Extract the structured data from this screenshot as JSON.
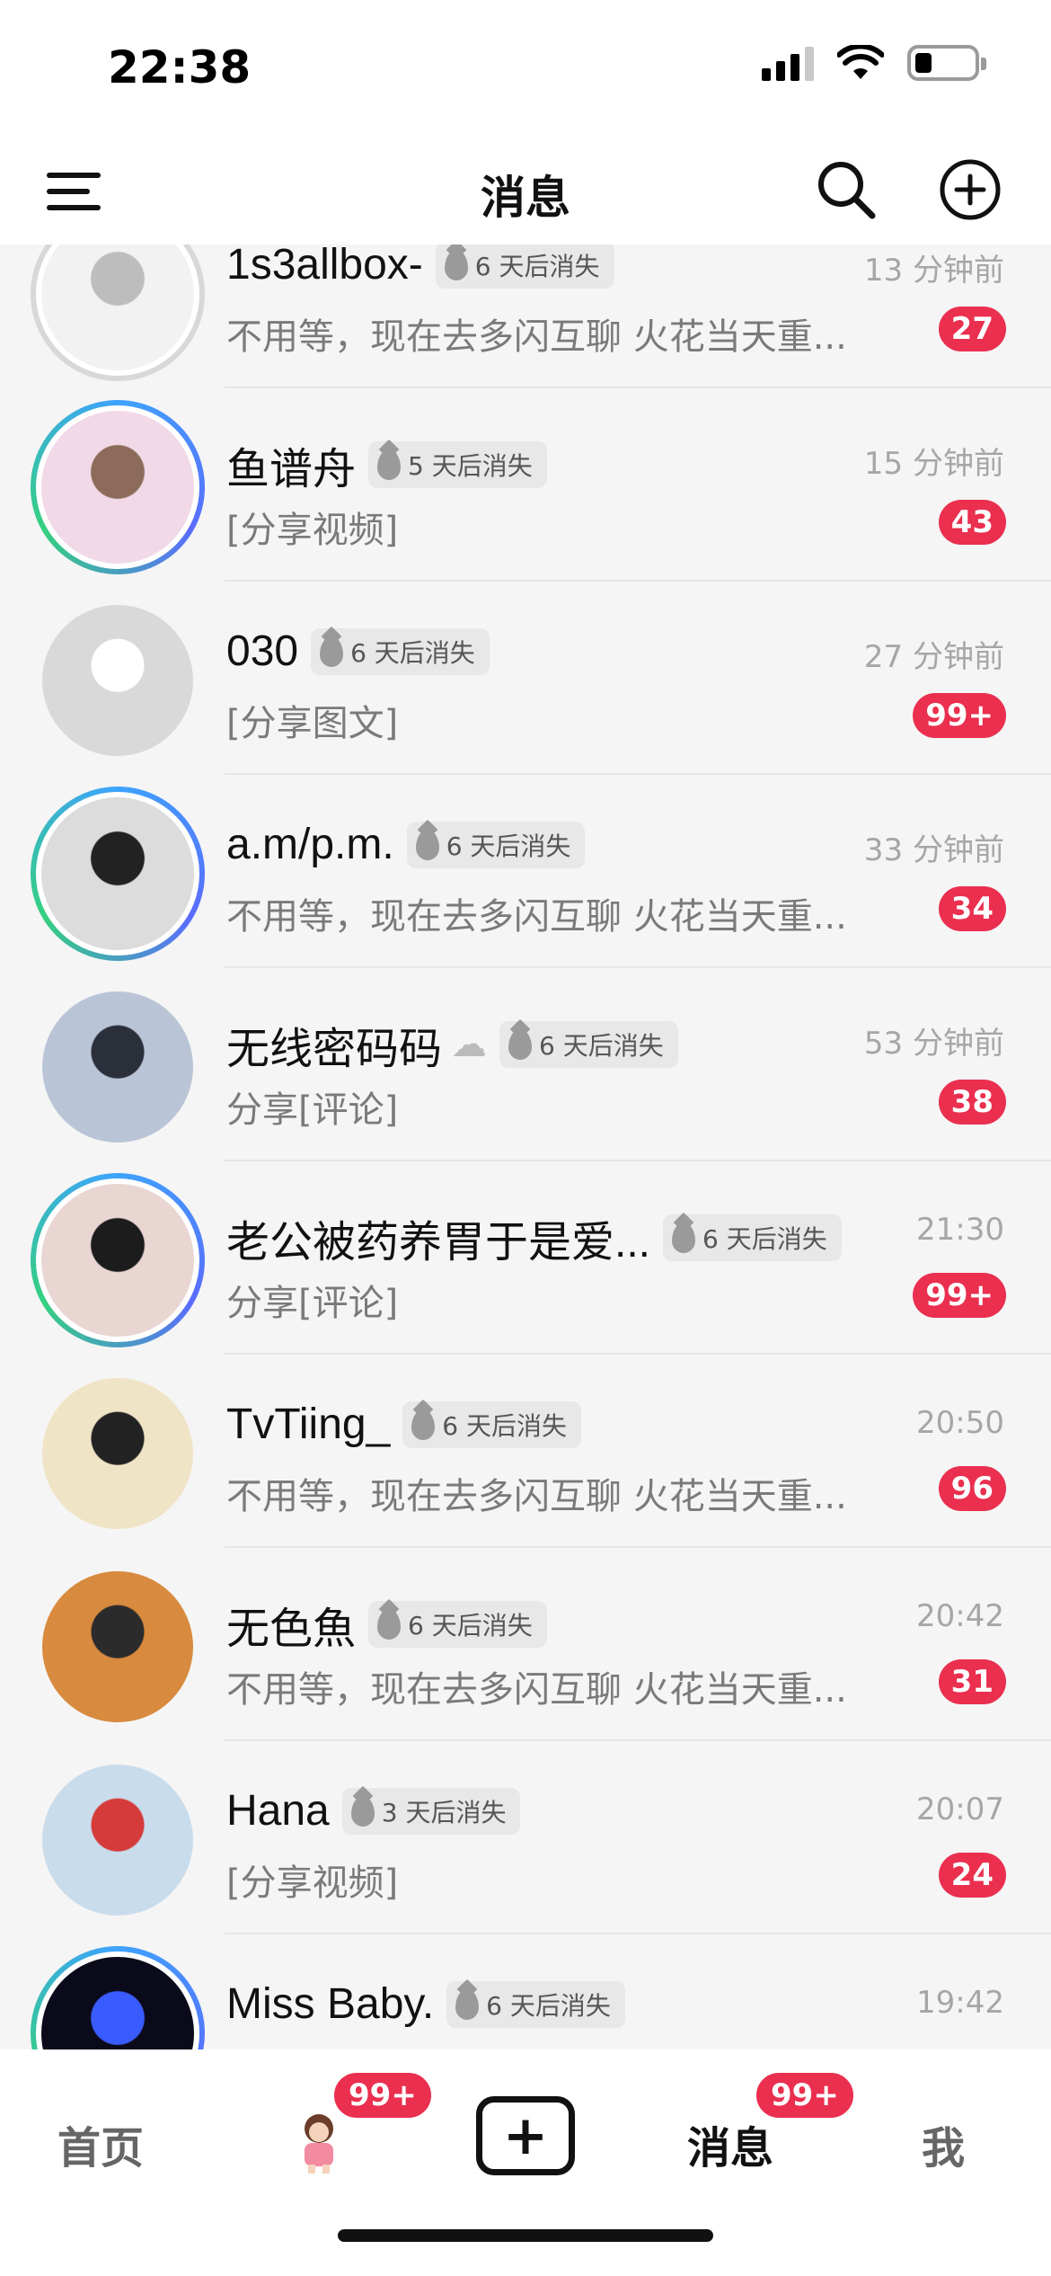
{
  "status_bar": {
    "time": "22:38"
  },
  "header": {
    "title": "消息"
  },
  "conversations": [
    {
      "name": "1s3allbox-",
      "tag": "6 天后消失",
      "time": "13 分钟前",
      "preview": "不用等，现在去多闪互聊 火花当天重...",
      "badge": "27",
      "avatar_style": "gray",
      "avatar_colors": [
        "#f2f2f2",
        "#bdbdbd"
      ]
    },
    {
      "name": "鱼谱舟",
      "tag": "5 天后消失",
      "time": "15 分钟前",
      "preview": "[分享视频]",
      "badge": "43",
      "avatar_style": "ring",
      "avatar_colors": [
        "#f1d9e8",
        "#8c6b5a"
      ]
    },
    {
      "name": "030",
      "tag": "6 天后消失",
      "time": "27 分钟前",
      "preview": "[分享图文]",
      "badge": "99+",
      "avatar_style": "plain",
      "avatar_colors": [
        "#d9d9d9",
        "#ffffff"
      ]
    },
    {
      "name": "a.m/p.m.",
      "tag": "6 天后消失",
      "time": "33 分钟前",
      "preview": "不用等，现在去多闪互聊 火花当天重...",
      "badge": "34",
      "avatar_style": "ring",
      "avatar_colors": [
        "#dcdcdc",
        "#222222"
      ]
    },
    {
      "name": "无线密码码",
      "cloud": "☁",
      "tag": "6 天后消失",
      "time": "53 分钟前",
      "preview": "分享[评论]",
      "badge": "38",
      "avatar_style": "plain",
      "avatar_colors": [
        "#b9c4d6",
        "#2a2f3a"
      ]
    },
    {
      "name": "老公被药养胃于是爱...",
      "tag": "6 天后消失",
      "time": "21:30",
      "preview": "分享[评论]",
      "badge": "99+",
      "avatar_style": "ring",
      "avatar_colors": [
        "#e9d6d3",
        "#1c1c1c"
      ]
    },
    {
      "name": "TvTiing_",
      "tag": "6 天后消失",
      "time": "20:50",
      "preview": "不用等，现在去多闪互聊 火花当天重...",
      "badge": "96",
      "avatar_style": "plain",
      "avatar_colors": [
        "#f0e4c6",
        "#222222"
      ]
    },
    {
      "name": "无色魚",
      "tag": "6 天后消失",
      "time": "20:42",
      "preview": "不用等，现在去多闪互聊 火花当天重...",
      "badge": "31",
      "avatar_style": "plain",
      "avatar_colors": [
        "#d88a3e",
        "#2b2b2b"
      ]
    },
    {
      "name": "Hana",
      "tag": "3 天后消失",
      "time": "20:07",
      "preview": "[分享视频]",
      "badge": "24",
      "avatar_style": "plain",
      "avatar_colors": [
        "#c9dcec",
        "#d63b3b"
      ]
    },
    {
      "name": "Miss Baby.",
      "tag": "6 天后消失",
      "time": "19:42",
      "preview": "",
      "badge": "",
      "avatar_style": "ring",
      "avatar_colors": [
        "#0a0a1a",
        "#3a5bff"
      ]
    }
  ],
  "tabbar": {
    "home": "首页",
    "friend_badge": "99+",
    "create": "+",
    "messages": "消息",
    "messages_badge": "99+",
    "me": "我"
  }
}
